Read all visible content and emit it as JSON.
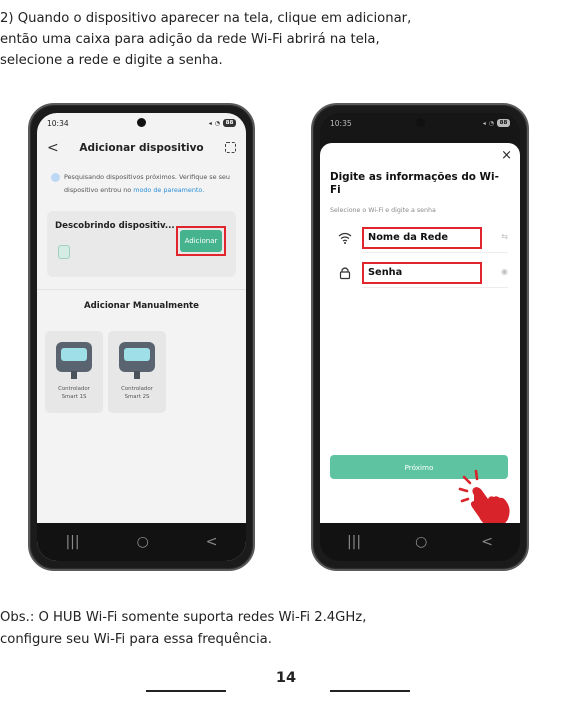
{
  "intro": {
    "line1": "2) Quando o dispositivo aparecer na tela, clique em adicionar,",
    "line2": "então uma caixa para adição da rede Wi-Fi abrirá na tela,",
    "line3": "selecione a rede e digite a senha."
  },
  "phone1": {
    "status_time": "10:34",
    "battery": "88",
    "header_title": "Adicionar dispositivo",
    "info_text": "Pesquisando dispositivos próximos. Verifique se seu",
    "info_text2": "dispositivo entrou no",
    "info_link": "modo de pareamento.",
    "discover_title": "Descobrindo dispositiv...",
    "add_button": "Adicionar",
    "manual_title": "Adicionar Manualmente",
    "tiles": [
      {
        "line1": "Controlador",
        "line2": "Smart 1S"
      },
      {
        "line1": "Controlador",
        "line2": "Smart 2S"
      }
    ]
  },
  "phone2": {
    "status_time": "10:35",
    "battery": "88",
    "title": "Digite as informações do Wi-Fi",
    "subtitle": "Selecione o Wi-Fi e digite a senha",
    "network_field": "Nome da Rede",
    "password_field": "Senha",
    "next_button": "Próximo"
  },
  "nav": {
    "recent": "|||",
    "home": "○",
    "back": "<"
  },
  "close_glyph": "×",
  "back_glyph": "<",
  "obs": {
    "line1": "Obs.: O HUB Wi-Fi somente suporta redes Wi-Fi 2.4GHz,",
    "line2": "configure seu Wi-Fi para essa frequência."
  },
  "page_number": "14",
  "colors": {
    "accent_green": "#44b38e",
    "highlight_red": "#e0262c",
    "hand_red": "#d9232b"
  }
}
